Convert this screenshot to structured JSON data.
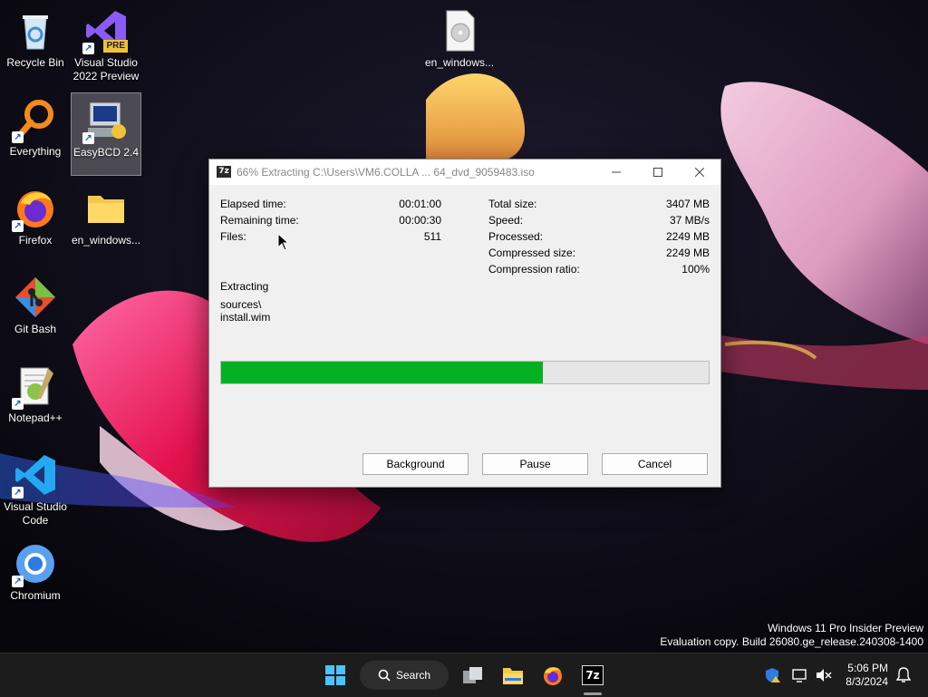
{
  "desktop": {
    "icons": [
      {
        "label": "Recycle Bin"
      },
      {
        "label": "Visual Studio 2022 Preview",
        "badge": "PRE"
      },
      {
        "label": "Everything"
      },
      {
        "label": "EasyBCD 2.4"
      },
      {
        "label": "Firefox"
      },
      {
        "label": "en_windows..."
      },
      {
        "label": "Git Bash"
      },
      {
        "label": "Notepad++"
      },
      {
        "label": "Visual Studio Code"
      },
      {
        "label": "Chromium"
      },
      {
        "label": "en_windows..."
      }
    ],
    "watermark": {
      "line1": "Windows 11 Pro Insider Preview",
      "line2": "Evaluation copy. Build 26080.ge_release.240308-1400"
    }
  },
  "dialog": {
    "app_icon_text": "7z",
    "title": "66% Extracting C:\\Users\\VM6.COLLA ... 64_dvd_9059483.iso",
    "stats_left": [
      {
        "label": "Elapsed time:",
        "value": "00:01:00"
      },
      {
        "label": "Remaining time:",
        "value": "00:00:30"
      },
      {
        "label": "Files:",
        "value": "511"
      }
    ],
    "stats_right": [
      {
        "label": "Total size:",
        "value": "3407 MB"
      },
      {
        "label": "Speed:",
        "value": "37 MB/s"
      },
      {
        "label": "Processed:",
        "value": "2249 MB"
      },
      {
        "label": "Compressed size:",
        "value": "2249 MB"
      },
      {
        "label": "Compression ratio:",
        "value": "100%"
      }
    ],
    "status": "Extracting",
    "path_line1": "sources\\",
    "path_line2": "install.wim",
    "progress_fraction": 0.66,
    "progress_color": "#06b025",
    "buttons": {
      "background": "Background",
      "pause": "Pause",
      "cancel": "Cancel"
    }
  },
  "taskbar": {
    "search_label": "Search",
    "active_app_text": "7z",
    "clock_time": "5:06 PM",
    "clock_date": "8/3/2024"
  }
}
